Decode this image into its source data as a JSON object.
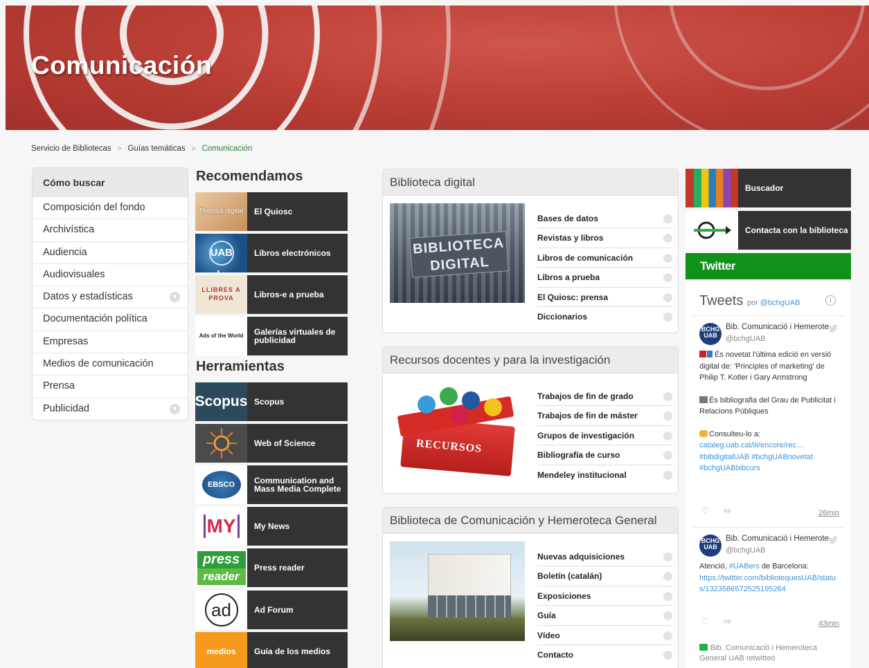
{
  "banner": {
    "title": "Comunicación"
  },
  "breadcrumb": {
    "items": [
      "Servicio de Bibliotecas",
      "Guías temáticas"
    ],
    "current": "Comunicación"
  },
  "leftmenu": {
    "header": "Cómo buscar",
    "items": [
      "Composición del fondo",
      "Archivística",
      "Audiencia",
      "Audiovisuales",
      "Datos y estadísticas",
      "Documentación política",
      "Empresas",
      "Medios de comunicación",
      "Prensa",
      "Publicidad"
    ]
  },
  "recomendamos": {
    "title": "Recomendamos",
    "items": [
      {
        "label": "El Quiosc",
        "thumb_text": "Premsa digital"
      },
      {
        "label": "Libros electrónicos",
        "thumb_text": "UAB le"
      },
      {
        "label": "Libros-e a prueba",
        "thumb_text": "LLIBRES A PROVA"
      },
      {
        "label": "Galerías virtuales de publicidad",
        "thumb_text": "Ads of the World"
      }
    ]
  },
  "herramientas": {
    "title": "Herramientas",
    "items": [
      {
        "label": "Scopus",
        "thumb_text": "Scopus"
      },
      {
        "label": "Web of Science",
        "thumb_text": ""
      },
      {
        "label": "Communication and Mass Media Complete",
        "thumb_text": "EBSCO"
      },
      {
        "label": "My News",
        "thumb_text": "MY"
      },
      {
        "label": "Press reader",
        "thumb_text_1": "press",
        "thumb_text_2": "reader"
      },
      {
        "label": "Ad Forum",
        "thumb_text": "ad"
      },
      {
        "label": "Guía de los medios",
        "thumb_text": "medios"
      }
    ]
  },
  "panels": [
    {
      "title": "Biblioteca digital",
      "image_text_1": "BIBLIOTECA",
      "image_text_2": "DIGITAL",
      "links": [
        "Bases de datos",
        "Revistas y libros",
        "Libros de comunicación",
        "Libros a prueba",
        "El Quiosc: prensa",
        "Diccionarios"
      ]
    },
    {
      "title": "Recursos docentes y para la investigación",
      "image_text": "RECURSOS",
      "links": [
        "Trabajos de fin de grado",
        "Trabajos de fin de máster",
        "Grupos de investigación",
        "Bibliografía de curso",
        "Mendeley institucional"
      ]
    },
    {
      "title": "Biblioteca de Comunicación y Hemeroteca General",
      "links": [
        "Nuevas adquisiciones",
        "Boletín (catalán)",
        "Exposiciones",
        "Guía",
        "Vídeo",
        "Contacto"
      ]
    }
  ],
  "right": {
    "buscador": "Buscador",
    "contacta": "Contacta con la biblioteca",
    "twitter": "Twitter"
  },
  "tweets": {
    "title": "Tweets",
    "by": "por",
    "by_handle": "@bchgUAB",
    "items": [
      {
        "name": "Bib. Comunicació i Hemeroteca",
        "handle": "@bchgUAB",
        "avatar_1": "BCHG",
        "avatar_2": "UAB",
        "line1": "És novetat l'última edició en versió digital de: 'Principles of marketing' de Philip T. Kotler i Gary Armstrong",
        "line2": "És bibliografia del Grau de Publicitat i Relacions Públiques",
        "line3": "Consulteu-lo a:",
        "link": "cataleg.uab.cat/iii/encore/rec…#bibdigitalUAB #bchgUABnovetat #bchgUABbibcurs",
        "time": "26min"
      },
      {
        "name": "Bib. Comunicació i Hemeroteca",
        "handle": "@bchgUAB",
        "avatar_1": "BCHG",
        "avatar_2": "UAB",
        "text_a": "Atenció, ",
        "hashtag": "#UABers",
        "text_b": " de Barcelona:",
        "link": "https://twitter.com/bibliotequesUAB/status/1323586572525195264",
        "time": "43min"
      }
    ],
    "retweet": "Bib. Comunicació i Hemeroteca General UAB retwitteó"
  },
  "colors": {
    "banner": "#c5433a",
    "tile": "#333333",
    "twitter_green": "#109118",
    "link": "#3b94d9",
    "breadcrumb_current": "#2e7d32"
  }
}
